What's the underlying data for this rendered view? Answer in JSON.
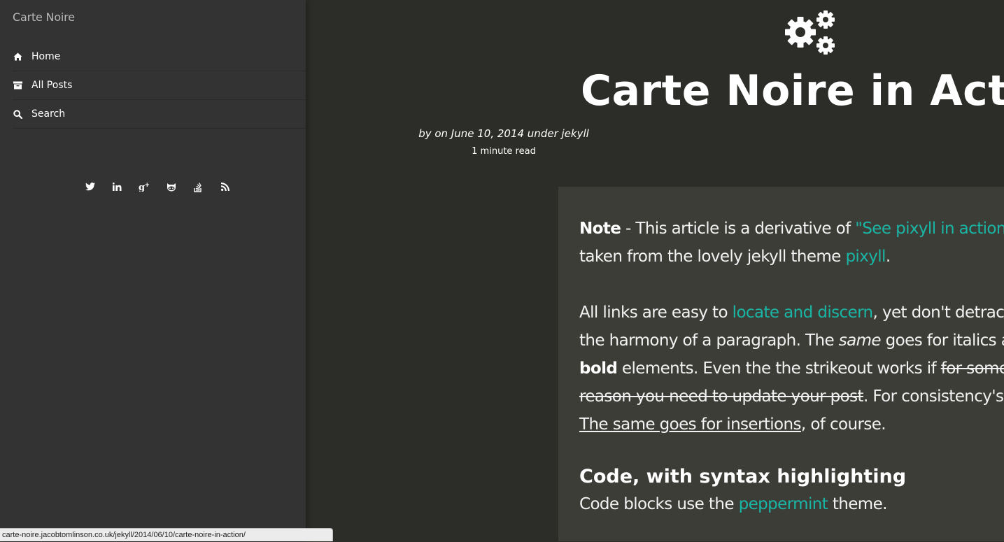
{
  "sidebar": {
    "site_title": "Carte Noire",
    "nav": [
      {
        "label": "Home",
        "icon": "home-icon"
      },
      {
        "label": "All Posts",
        "icon": "archive-icon"
      },
      {
        "label": "Search",
        "icon": "search-icon"
      }
    ],
    "social": [
      "twitter-icon",
      "linkedin-icon",
      "google-plus-icon",
      "github-icon",
      "stack-overflow-icon",
      "rss-icon"
    ]
  },
  "post": {
    "title": "Carte Noire in Action",
    "meta": "by on June 10, 2014 under jekyll",
    "read_time": "1 minute read",
    "p1": {
      "note_label": "Note",
      "t1": " - This article is a derivative of ",
      "link1": "\"See pixyll in action\"",
      "t2": ",",
      "t3": "taken from the lovely jekyll theme ",
      "link2": "pixyll",
      "t4": "."
    },
    "p2": {
      "t1": "All links are easy to ",
      "link1": "locate and discern",
      "t2": ", yet don't detract f",
      "t3": "the harmony of a paragraph. The ",
      "em1": "same",
      "t4": " goes for italics an",
      "strong1": "bold",
      "t5": " elements. Even the the strikeout works if ",
      "del1": "for some",
      "del2": "reason you need to update your post",
      "t6": ". For consistency's s",
      "ins1": "The same goes for insertions",
      "t7": ", of course."
    },
    "h2": "Code, with syntax highlighting",
    "p3": {
      "t1": "Code blocks use the ",
      "link1": "peppermint",
      "t2": " theme."
    }
  },
  "statusbar": {
    "url": "carte-noire.jacobtomlinson.co.uk/jekyll/2014/06/10/carte-noire-in-action/"
  },
  "colors": {
    "background": "#2c2c29",
    "sidebar": "#333333",
    "card": "#3d3d38",
    "link": "#19b5a5"
  }
}
